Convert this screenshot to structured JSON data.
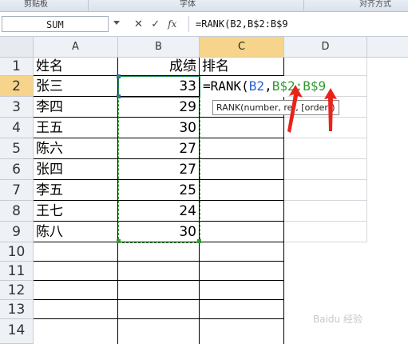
{
  "ribbon": {
    "groups": [
      "剪贴板",
      "字体",
      "对齐方式"
    ]
  },
  "formula_bar": {
    "name_box": "SUM",
    "buttons": {
      "cancel": "✕",
      "enter": "✓",
      "function": "fx"
    },
    "formula": "=RANK(B2,B$2:B$9"
  },
  "sheet": {
    "columns": [
      "A",
      "B",
      "C",
      "D"
    ],
    "rows": [
      "1",
      "2",
      "3",
      "4",
      "5",
      "6",
      "7",
      "8",
      "9",
      "10",
      "11",
      "12",
      "13",
      "14"
    ],
    "header": {
      "a": "姓名",
      "b": "成绩",
      "c": "排名"
    },
    "data": [
      {
        "name": "张三",
        "score": "33"
      },
      {
        "name": "李四",
        "score": "29"
      },
      {
        "name": "王五",
        "score": "30"
      },
      {
        "name": "陈六",
        "score": "27"
      },
      {
        "name": "张四",
        "score": "27"
      },
      {
        "name": "李五",
        "score": "25"
      },
      {
        "name": "王七",
        "score": "24"
      },
      {
        "name": "陈八",
        "score": "30"
      }
    ],
    "active_cell": {
      "prefix": "=RANK(",
      "ref1": "B2",
      "comma": ",",
      "ref2": "B$2:B$9"
    }
  },
  "tooltip": "RANK(number, ref, [order])",
  "colors": {
    "ref1": "#2563d6",
    "ref2": "#2f9a2f",
    "arrow": "#e8231b",
    "selected_header": "#f6d48b"
  },
  "watermark": "Baidu 经验"
}
